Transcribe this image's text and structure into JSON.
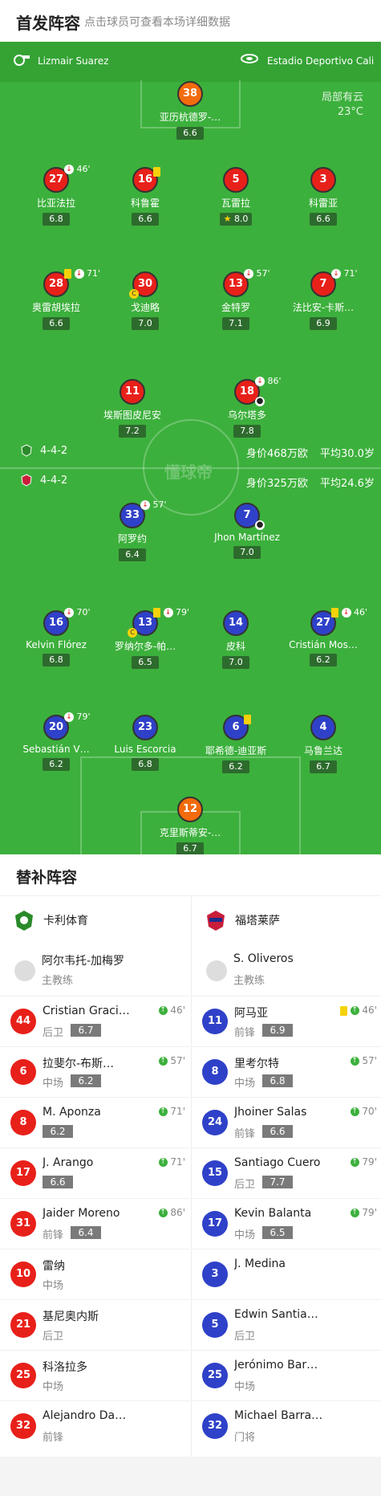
{
  "header": {
    "title": "首发阵容",
    "hint": "点击球员可查看本场详细数据"
  },
  "match": {
    "referee": "Lizmair Suarez",
    "stadium": "Estadio Deportivo Cali",
    "weather": "局部有云",
    "temperature": "23°C",
    "watermark": "懂球帝"
  },
  "home_formation": {
    "formation": "4-4-2",
    "value": "身价468万欧",
    "age": "平均30.0岁"
  },
  "away_formation": {
    "formation": "4-4-2",
    "value": "身价325万欧",
    "age": "平均24.6岁"
  },
  "home_players": [
    {
      "num": "38",
      "name": "亚历杭德罗-…",
      "rating": "6.6"
    },
    {
      "num": "27",
      "name": "比亚法拉",
      "rating": "6.8",
      "event": "46'"
    },
    {
      "num": "16",
      "name": "科鲁霍",
      "rating": "6.6"
    },
    {
      "num": "5",
      "name": "瓦雷拉",
      "rating": "8.0"
    },
    {
      "num": "3",
      "name": "科雷亚",
      "rating": "6.6"
    },
    {
      "num": "28",
      "name": "奥雷胡埃拉",
      "rating": "6.6",
      "event": "71'"
    },
    {
      "num": "30",
      "name": "戈迪略",
      "rating": "7.0"
    },
    {
      "num": "13",
      "name": "金特罗",
      "rating": "7.1",
      "event": "57'"
    },
    {
      "num": "7",
      "name": "法比安-卡斯…",
      "rating": "6.9",
      "event": "71'"
    },
    {
      "num": "11",
      "name": "埃斯图皮尼安",
      "rating": "7.2"
    },
    {
      "num": "18",
      "name": "乌尔塔多",
      "rating": "7.8",
      "event": "86'"
    }
  ],
  "away_players": [
    {
      "num": "33",
      "name": "阿罗约",
      "rating": "6.4",
      "event": "57'"
    },
    {
      "num": "7",
      "name": "Jhon Martínez",
      "rating": "7.0"
    },
    {
      "num": "16",
      "name": "Kelvin Flórez",
      "rating": "6.8",
      "event": "70'"
    },
    {
      "num": "13",
      "name": "罗纳尔多-帕…",
      "rating": "6.5",
      "event": "79'"
    },
    {
      "num": "14",
      "name": "皮科",
      "rating": "7.0"
    },
    {
      "num": "27",
      "name": "Cristián Mos…",
      "rating": "6.2",
      "event": "46'"
    },
    {
      "num": "20",
      "name": "Sebastián V…",
      "rating": "6.2",
      "event": "79'"
    },
    {
      "num": "23",
      "name": "Luis Escorcia",
      "rating": "6.8"
    },
    {
      "num": "6",
      "name": "耶希德-迪亚斯",
      "rating": "6.2"
    },
    {
      "num": "4",
      "name": "马鲁兰达",
      "rating": "6.7"
    },
    {
      "num": "12",
      "name": "克里斯蒂安-…",
      "rating": "6.7"
    }
  ],
  "subs": {
    "title": "替补阵容",
    "home": {
      "team": "卡利体育",
      "coach": {
        "name": "阿尔韦托-加梅罗",
        "role": "主教练"
      },
      "players": [
        {
          "num": "44",
          "name": "Cristian Graci…",
          "pos": "后卫",
          "rating": "6.7",
          "min": "46'"
        },
        {
          "num": "6",
          "name": "拉斐尔-布斯…",
          "pos": "中场",
          "rating": "6.2",
          "min": "57'"
        },
        {
          "num": "8",
          "name": "M. Aponza",
          "pos": "",
          "rating": "6.2",
          "min": "71'"
        },
        {
          "num": "17",
          "name": "J. Arango",
          "pos": "",
          "rating": "6.6",
          "min": "71'"
        },
        {
          "num": "31",
          "name": "Jaider Moreno",
          "pos": "前锋",
          "rating": "6.4",
          "min": "86'"
        },
        {
          "num": "10",
          "name": "雷纳",
          "pos": "中场",
          "rating": "",
          "min": ""
        },
        {
          "num": "21",
          "name": "基尼奥内斯",
          "pos": "后卫",
          "rating": "",
          "min": ""
        },
        {
          "num": "25",
          "name": "科洛拉多",
          "pos": "中场",
          "rating": "",
          "min": ""
        },
        {
          "num": "32",
          "name": "Alejandro Da…",
          "pos": "前锋",
          "rating": "",
          "min": ""
        }
      ]
    },
    "away": {
      "team": "福塔莱萨",
      "coach": {
        "name": "S. Oliveros",
        "role": "主教练"
      },
      "players": [
        {
          "num": "11",
          "name": "阿马亚",
          "pos": "前锋",
          "rating": "6.9",
          "min": "46'"
        },
        {
          "num": "8",
          "name": "里考尔特",
          "pos": "中场",
          "rating": "6.8",
          "min": "57'"
        },
        {
          "num": "24",
          "name": "Jhoiner Salas",
          "pos": "前锋",
          "rating": "6.6",
          "min": "70'"
        },
        {
          "num": "15",
          "name": "Santiago Cuero",
          "pos": "后卫",
          "rating": "7.7",
          "min": "79'"
        },
        {
          "num": "17",
          "name": "Kevin Balanta",
          "pos": "中场",
          "rating": "6.5",
          "min": "79'"
        },
        {
          "num": "3",
          "name": "J. Medina",
          "pos": "",
          "rating": "",
          "min": ""
        },
        {
          "num": "5",
          "name": "Edwin Santia…",
          "pos": "后卫",
          "rating": "",
          "min": ""
        },
        {
          "num": "25",
          "name": "Jerónimo Bar…",
          "pos": "中场",
          "rating": "",
          "min": ""
        },
        {
          "num": "32",
          "name": "Michael Barra…",
          "pos": "门将",
          "rating": "",
          "min": ""
        }
      ]
    }
  }
}
